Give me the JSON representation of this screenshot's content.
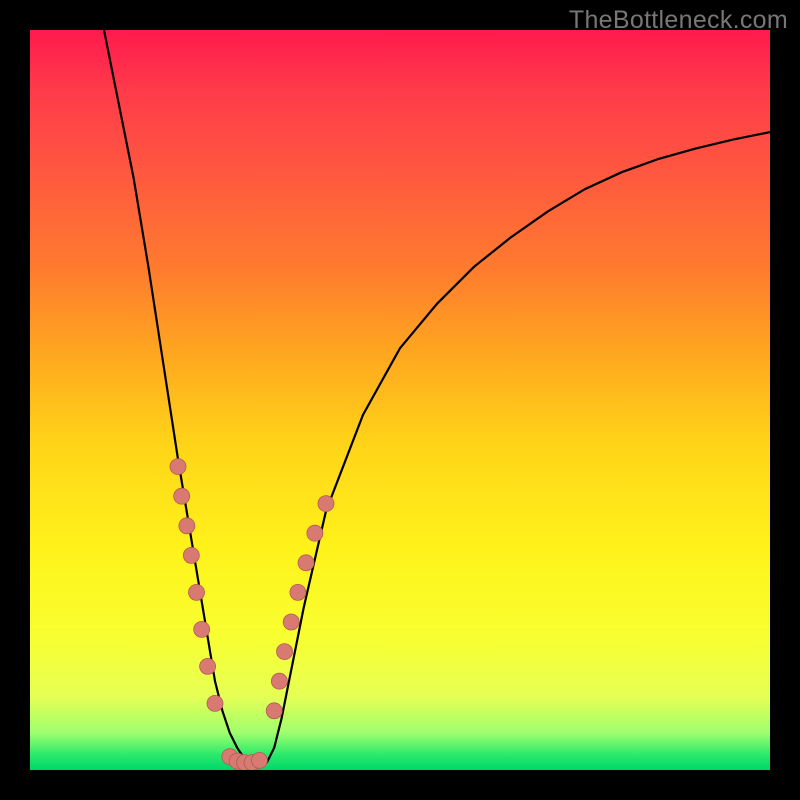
{
  "watermark": "TheBottleneck.com",
  "colors": {
    "frame": "#000000",
    "dot_fill": "#d97a72",
    "dot_stroke": "#b25a54",
    "curve": "#000000",
    "gradient_top": "#ff1a4d",
    "gradient_bottom": "#00d66a"
  },
  "chart_data": {
    "type": "line",
    "title": "",
    "xlabel": "",
    "ylabel": "",
    "xlim": [
      0,
      100
    ],
    "ylim": [
      0,
      100
    ],
    "x": [
      10,
      12,
      14,
      16,
      18,
      20,
      21,
      22,
      23,
      24,
      25,
      26,
      27,
      28,
      29,
      30,
      31,
      32,
      33,
      34,
      35,
      37,
      40,
      45,
      50,
      55,
      60,
      65,
      70,
      75,
      80,
      85,
      90,
      95,
      100
    ],
    "y": [
      100,
      90,
      80,
      68,
      55,
      42,
      36,
      30,
      24,
      18,
      12,
      8,
      5,
      3,
      1.5,
      0.8,
      0.5,
      1,
      3,
      7,
      12,
      22,
      35,
      48,
      57,
      63,
      68,
      72,
      75.5,
      78.5,
      80.8,
      82.6,
      84,
      85.2,
      86.2
    ],
    "series": [
      {
        "name": "left-branch-dots",
        "x": [
          20.0,
          20.5,
          21.2,
          21.8,
          22.5,
          23.2,
          24.0,
          25.0
        ],
        "y": [
          41,
          37,
          33,
          29,
          24,
          19,
          14,
          9
        ]
      },
      {
        "name": "trough-dots",
        "x": [
          27.0,
          28.0,
          29.0,
          30.0,
          31.0
        ],
        "y": [
          1.8,
          1.2,
          1.0,
          1.0,
          1.3
        ]
      },
      {
        "name": "right-branch-dots",
        "x": [
          33.0,
          33.7,
          34.4,
          35.3,
          36.2,
          37.3,
          38.5,
          40.0
        ],
        "y": [
          8,
          12,
          16,
          20,
          24,
          28,
          32,
          36
        ]
      }
    ]
  }
}
